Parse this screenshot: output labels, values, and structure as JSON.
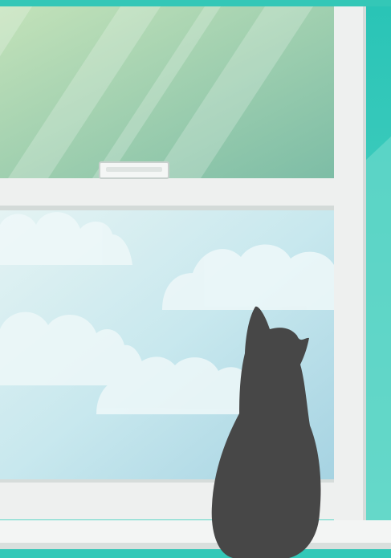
{
  "scene": {
    "subject": "cat",
    "colors": {
      "wall_teal": "#2fc9b8",
      "wall_teal_light": "#62d9c9",
      "window_frame": "#eef0ef",
      "frame_shadow": "#cfd6d4",
      "upper_glass_top": "#b9dcb3",
      "upper_glass_bottom": "#7fc0a5",
      "sky_top": "#a9d8e0",
      "sky_bottom": "#d7eff3",
      "cloud": "#e9f6f8",
      "cat": "#474747",
      "sill": "#f1f3f2"
    }
  }
}
